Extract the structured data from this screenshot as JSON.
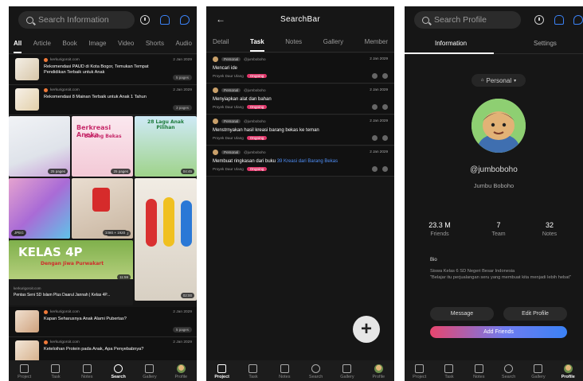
{
  "screen1": {
    "search_placeholder": "Search Information",
    "tabs": [
      "All",
      "Article",
      "Book",
      "Image",
      "Video",
      "Shorts",
      "Audio"
    ],
    "items": [
      {
        "source": "kerkurigoroit.com",
        "date": "2 Jan 2029",
        "title": "Rekomendasi PAUD di Kota Bogor, Temukan Tempat Pendidikan Terbaik untuk Anak",
        "pages": "5 pages"
      },
      {
        "source": "kerkurigoroit.com",
        "date": "2 Jan 2029",
        "title": "Rekomendasi 8 Mainan Terbaik untuk Anak 1 Tahun",
        "pages": "3 pages"
      }
    ],
    "tiles": [
      {
        "badge": "25 pages"
      },
      {
        "heading": "Berkreasi Aneka",
        "sub": "Barang Bekas",
        "badge": "25 pages"
      },
      {
        "heading": "28 Lagu Anak Pilihan",
        "badge": "04:45"
      },
      {
        "badge": "JPEG"
      },
      {
        "badge": "1080 × 1920"
      },
      {
        "badge": "02:00"
      },
      {
        "badge": "JPEG"
      },
      {
        "badge": "1080 × 1920"
      },
      {
        "heading": "KELAS 4P",
        "banner": "Dengan Jiwa Purwakart",
        "badge": "11:59",
        "source": "kerkurigoroit.com",
        "caption": "Pentas Seni SD Islam Plus Daarul Jannah | Kelas 4P..."
      }
    ],
    "items_bottom": [
      {
        "source": "kerkurigoroit.com",
        "date": "2 Jan 2029",
        "title": "Kapan Seharusnya Anak Alami Pubertas?",
        "pages": "5 pages"
      },
      {
        "source": "kerkurigoroit.com",
        "date": "2 Jan 2029",
        "title": "Keteloihan Protein pada Anak, Apa Penyebabnya?",
        "pages": ""
      }
    ]
  },
  "screen2": {
    "title": "SearchBar",
    "tabs": [
      "Detail",
      "Task",
      "Notes",
      "Gallery",
      "Member"
    ],
    "tasks": [
      {
        "user_badge": "Personal",
        "user": "@jumboboho",
        "date": "2 Jan 2029",
        "title": "Mencari ide",
        "highlight": "",
        "project": "Proyek Daur Ulang",
        "status": "Ongoing"
      },
      {
        "user_badge": "Personal",
        "user": "@jumboboho",
        "date": "2 Jan 2029",
        "title": "Menyiapkan alat dan bahan",
        "highlight": "",
        "project": "Proyek Daur Ulang",
        "status": "Ongoing"
      },
      {
        "user_badge": "Personal",
        "user": "@jumboboho",
        "date": "2 Jan 2029",
        "title": "Menstrnyakan hasil kreasi barang bekas ke teman",
        "highlight": "",
        "project": "Proyek Daur Ulang",
        "status": "Ongoing"
      },
      {
        "user_badge": "Personal",
        "user": "@jumboboho",
        "date": "2 Jan 2029",
        "title": "Membuat ringkasan dari buku ",
        "highlight": "39 Kreasi dari Barang Bekas",
        "project": "Proyek Daur Ulang",
        "status": "Ongoing"
      }
    ],
    "fab": "+"
  },
  "screen3": {
    "search_placeholder": "Search Profile",
    "tabs": [
      "Information",
      "Settings"
    ],
    "mode": "Personal",
    "handle": "@jumboboho",
    "name": "Jumbu Boboho",
    "stats": [
      {
        "value": "23.3 M",
        "label": "Friends"
      },
      {
        "value": "7",
        "label": "Team"
      },
      {
        "value": "32",
        "label": "Notes"
      }
    ],
    "bio_label": "Bio",
    "bio_line1": "Siswa Kelas 6 SD Negeri Besar Indonesia",
    "bio_line2": "\"Belajar itu perjualangan seru yang membuat kita menjadi lebih hebat\"",
    "message": "Message",
    "edit_profile": "Edit Profile",
    "add_friends": "Add Friends"
  },
  "nav": [
    "Project",
    "Task",
    "Notes",
    "Search",
    "Gallery",
    "Profile"
  ],
  "colors": {
    "accent": "#3b82f6",
    "status": "#e0386b",
    "background": "#161616"
  }
}
